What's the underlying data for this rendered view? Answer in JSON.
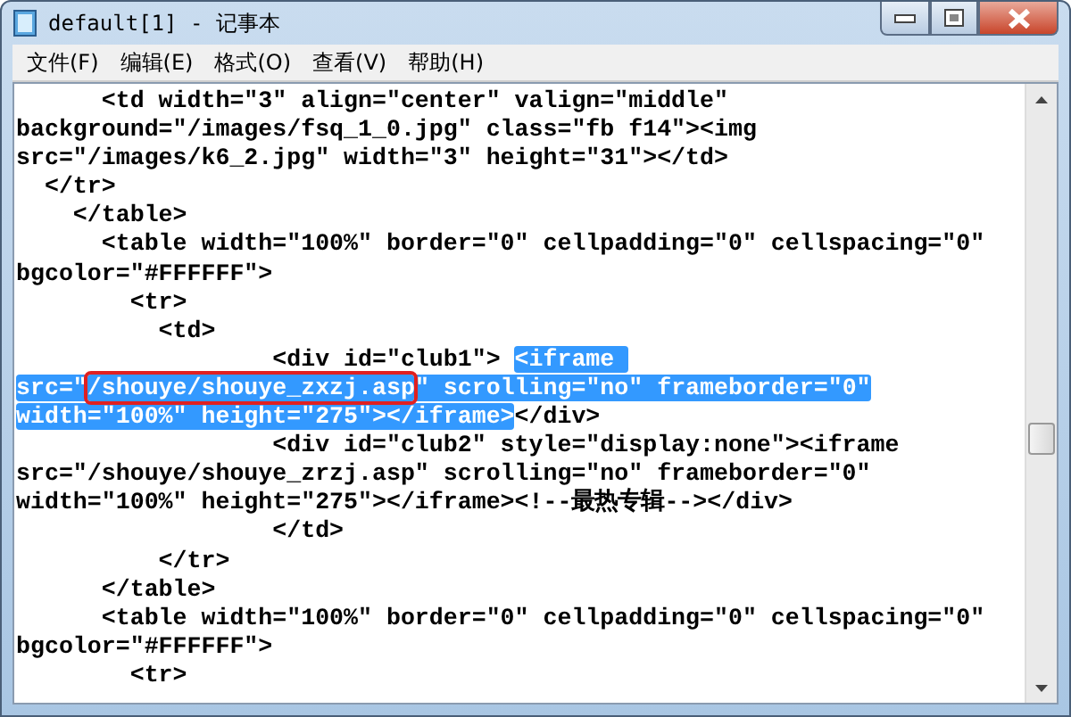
{
  "window": {
    "title": "default[1] - 记事本"
  },
  "menu": [
    {
      "label": "文件(F)"
    },
    {
      "label": "编辑(E)"
    },
    {
      "label": "格式(O)"
    },
    {
      "label": "查看(V)"
    },
    {
      "label": "帮助(H)"
    }
  ],
  "lines": [
    [
      {
        "text": "      <td width=\"3\" align=\"center\" valign=\"middle\"",
        "selected": false,
        "boxed": false
      }
    ],
    [
      {
        "text": "background=\"/images/fsq_1_0.jpg\" class=\"fb f14\"><img",
        "selected": false,
        "boxed": false
      }
    ],
    [
      {
        "text": "src=\"/images/k6_2.jpg\" width=\"3\" height=\"31\"></td>",
        "selected": false,
        "boxed": false
      }
    ],
    [
      {
        "text": "  </tr>",
        "selected": false,
        "boxed": false
      }
    ],
    [
      {
        "text": "    </table>",
        "selected": false,
        "boxed": false
      }
    ],
    [
      {
        "text": "      <table width=\"100%\" border=\"0\" cellpadding=\"0\" cellspacing=\"0\"",
        "selected": false,
        "boxed": false
      }
    ],
    [
      {
        "text": "bgcolor=\"#FFFFFF\">",
        "selected": false,
        "boxed": false
      }
    ],
    [
      {
        "text": "        <tr>",
        "selected": false,
        "boxed": false
      }
    ],
    [
      {
        "text": "          <td>",
        "selected": false,
        "boxed": false
      }
    ],
    [
      {
        "text": "                  <div id=\"club1\"> ",
        "selected": false,
        "boxed": false
      },
      {
        "text": "<iframe ",
        "selected": true,
        "boxed": false
      }
    ],
    [
      {
        "text": "src=\"",
        "selected": true,
        "boxed": false
      },
      {
        "text": "/shouye/shouye_zxzj.asp",
        "selected": true,
        "boxed": true
      },
      {
        "text": "\" scrolling=\"no\" frameborder=\"0\"",
        "selected": true,
        "boxed": false
      }
    ],
    [
      {
        "text": "width=\"100%\" height=\"275\"></iframe>",
        "selected": true,
        "boxed": false
      },
      {
        "text": "</div>",
        "selected": false,
        "boxed": false
      }
    ],
    [
      {
        "text": "                  <div id=\"club2\" style=\"display:none\"><iframe",
        "selected": false,
        "boxed": false
      }
    ],
    [
      {
        "text": "src=\"/shouye/shouye_zrzj.asp\" scrolling=\"no\" frameborder=\"0\"",
        "selected": false,
        "boxed": false
      }
    ],
    [
      {
        "text": "width=\"100%\" height=\"275\"></iframe><!--最热专辑--></div>",
        "selected": false,
        "boxed": false
      }
    ],
    [
      {
        "text": "                  </td>",
        "selected": false,
        "boxed": false
      }
    ],
    [
      {
        "text": "          </tr>",
        "selected": false,
        "boxed": false
      }
    ],
    [
      {
        "text": "      </table>",
        "selected": false,
        "boxed": false
      }
    ],
    [
      {
        "text": "      <table width=\"100%\" border=\"0\" cellpadding=\"0\" cellspacing=\"0\"",
        "selected": false,
        "boxed": false
      }
    ],
    [
      {
        "text": "bgcolor=\"#FFFFFF\">",
        "selected": false,
        "boxed": false
      }
    ],
    [
      {
        "text": "        <tr>",
        "selected": false,
        "boxed": false
      }
    ]
  ]
}
